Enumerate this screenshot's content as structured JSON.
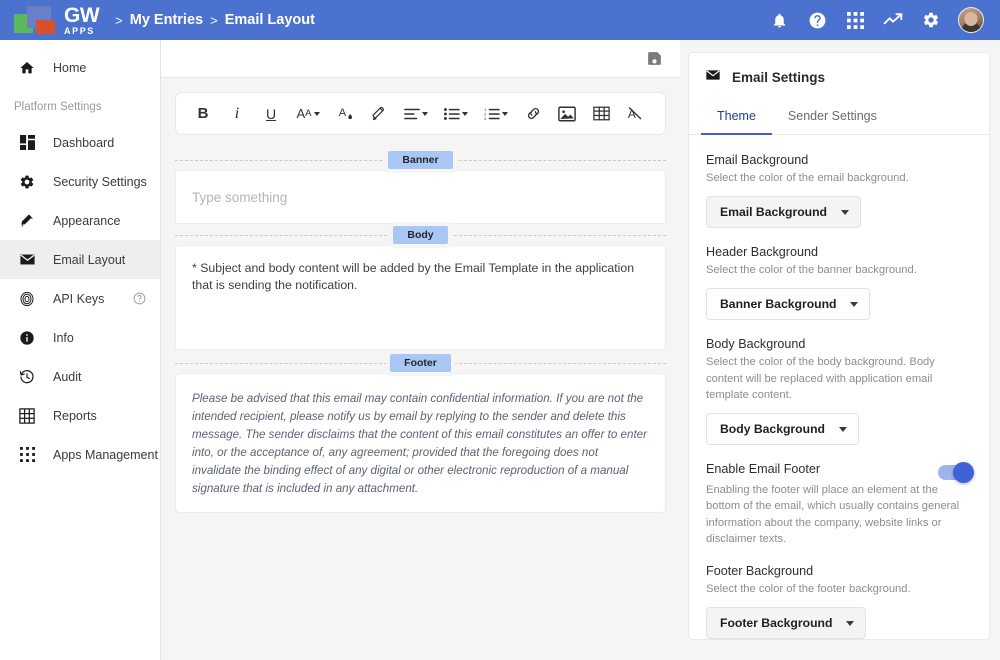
{
  "header": {
    "logo": {
      "name_primary": "GW",
      "name_secondary": "APPS"
    },
    "breadcrumb": {
      "sep1": ">",
      "item1": "My Entries",
      "sep2": ">",
      "item2": "Email Layout"
    },
    "icons": [
      "bell-icon",
      "help-icon",
      "apps-grid-icon",
      "trending-icon",
      "gear-icon",
      "avatar"
    ]
  },
  "sidebar": {
    "home": {
      "label": "Home",
      "icon": "home-icon"
    },
    "section_label": "Platform Settings",
    "items": [
      {
        "label": "Dashboard",
        "icon": "dashboard-icon"
      },
      {
        "label": "Security Settings",
        "icon": "gear-icon"
      },
      {
        "label": "Appearance",
        "icon": "appearance-icon"
      },
      {
        "label": "Email Layout",
        "icon": "envelope-icon",
        "active": true
      },
      {
        "label": "API Keys",
        "icon": "fingerprint-icon",
        "help": "?"
      },
      {
        "label": "Info",
        "icon": "info-icon"
      },
      {
        "label": "Audit",
        "icon": "history-icon"
      },
      {
        "label": "Reports",
        "icon": "table-icon"
      },
      {
        "label": "Apps Management",
        "icon": "apps-dots-icon"
      }
    ]
  },
  "center": {
    "save_label": "Save",
    "toolbar": [
      {
        "name": "bold",
        "glyph": "B"
      },
      {
        "name": "italic",
        "glyph": "i"
      },
      {
        "name": "underline",
        "glyph": "U"
      },
      {
        "name": "font-size",
        "glyph": "AA"
      },
      {
        "name": "text-color",
        "glyph": "A"
      },
      {
        "name": "highlight",
        "glyph": "pen"
      },
      {
        "name": "align",
        "glyph": "align"
      },
      {
        "name": "bullet-list",
        "glyph": "ul"
      },
      {
        "name": "numbered-list",
        "glyph": "ol"
      },
      {
        "name": "link",
        "glyph": "link"
      },
      {
        "name": "image",
        "glyph": "image"
      },
      {
        "name": "table",
        "glyph": "table"
      },
      {
        "name": "clear-format",
        "glyph": "clear"
      }
    ],
    "banner": {
      "chip": "Banner",
      "placeholder": "Type something"
    },
    "body": {
      "chip": "Body",
      "text": "* Subject and body content will be added by the Email Template in the application that is sending the notification."
    },
    "footer": {
      "chip": "Footer",
      "text": "Please be advised that this email may contain confidential information. If you are not the intended recipient, please notify us by email by replying to the sender and delete this message. The sender disclaims that the content of this email constitutes an offer to enter into, or the acceptance of, any agreement; provided that the foregoing does not invalidate the binding effect of any digital or other electronic reproduction of a manual signature that is included in any attachment."
    }
  },
  "right_panel": {
    "title": "Email Settings",
    "title_icon": "envelope-icon",
    "tabs": [
      {
        "label": "Theme",
        "active": true
      },
      {
        "label": "Sender Settings",
        "active": false
      }
    ],
    "fields": [
      {
        "label": "Email Background",
        "desc": "Select the color of the email background.",
        "dropdown": "Email Background"
      },
      {
        "label": "Header Background",
        "desc": "Select the color of the banner background.",
        "dropdown": "Banner Background"
      },
      {
        "label": "Body Background",
        "desc": "Select the color of the body background. Body content will be replaced with application email template content.",
        "dropdown": "Body Background"
      }
    ],
    "toggle": {
      "label": "Enable Email Footer",
      "desc": "Enabling the footer will place an element at the bottom of the email, which usually contains general information about the company, website links or disclaimer texts.",
      "state": "on"
    },
    "footer_field": {
      "label": "Footer Background",
      "desc": "Select the color of the footer background.",
      "dropdown": "Footer Background"
    }
  },
  "colors": {
    "header_blue": "#4a72ce",
    "accent_blue": "#3f62d8",
    "chip_blue": "#a8c7f5",
    "active_nav": "#eeeeee"
  }
}
